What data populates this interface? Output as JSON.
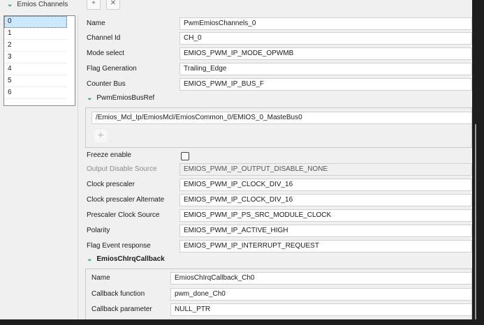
{
  "header": {
    "title": "Emios Channels",
    "add_label": "+",
    "remove_label": "✕"
  },
  "channels": [
    "0",
    "1",
    "2",
    "3",
    "4",
    "5",
    "6"
  ],
  "fields": [
    {
      "label": "Name",
      "value": "PwmEmiosChannels_0"
    },
    {
      "label": "Channel Id",
      "value": "CH_0"
    },
    {
      "label": "Mode select",
      "value": "EMIOS_PWM_IP_MODE_OPWMB"
    },
    {
      "label": "Flag Generation",
      "value": "Trailing_Edge"
    },
    {
      "label": "Counter Bus",
      "value": "EMIOS_PWM_IP_BUS_F"
    }
  ],
  "bus_ref": {
    "title": "PwmEmiosBusRef",
    "value": "/Emios_Mcl_Ip/EmiosMcl/EmiosCommon_0/EMIOS_0_MasteBus0",
    "add_label": "+"
  },
  "freeze": {
    "label": "Freeze enable",
    "checked": false
  },
  "output_disable": {
    "label": "Output Disable Source",
    "value": "EMIOS_PWM_IP_OUTPUT_DISABLE_NONE"
  },
  "fields2": [
    {
      "label": "Clock prescaler",
      "value": "EMIOS_PWM_IP_CLOCK_DIV_16"
    },
    {
      "label": "Clock prescaler Alternate",
      "value": "EMIOS_PWM_IP_CLOCK_DIV_16"
    },
    {
      "label": "Prescaler Clock Source",
      "value": "EMIOS_PWM_IP_PS_SRC_MODULE_CLOCK"
    },
    {
      "label": "Polarity",
      "value": "EMIOS_PWM_IP_ACTIVE_HIGH"
    },
    {
      "label": "Flag Event response",
      "value": "EMIOS_PWM_IP_INTERRUPT_REQUEST"
    }
  ],
  "callback": {
    "title": "EmiosChIrqCallback",
    "fields": [
      {
        "label": "Name",
        "value": "EmiosChIrqCallback_Ch0"
      },
      {
        "label": "Callback function",
        "value": "pwm_done_Ch0"
      },
      {
        "label": "Callback parameter",
        "value": "NULL_PTR"
      }
    ]
  }
}
